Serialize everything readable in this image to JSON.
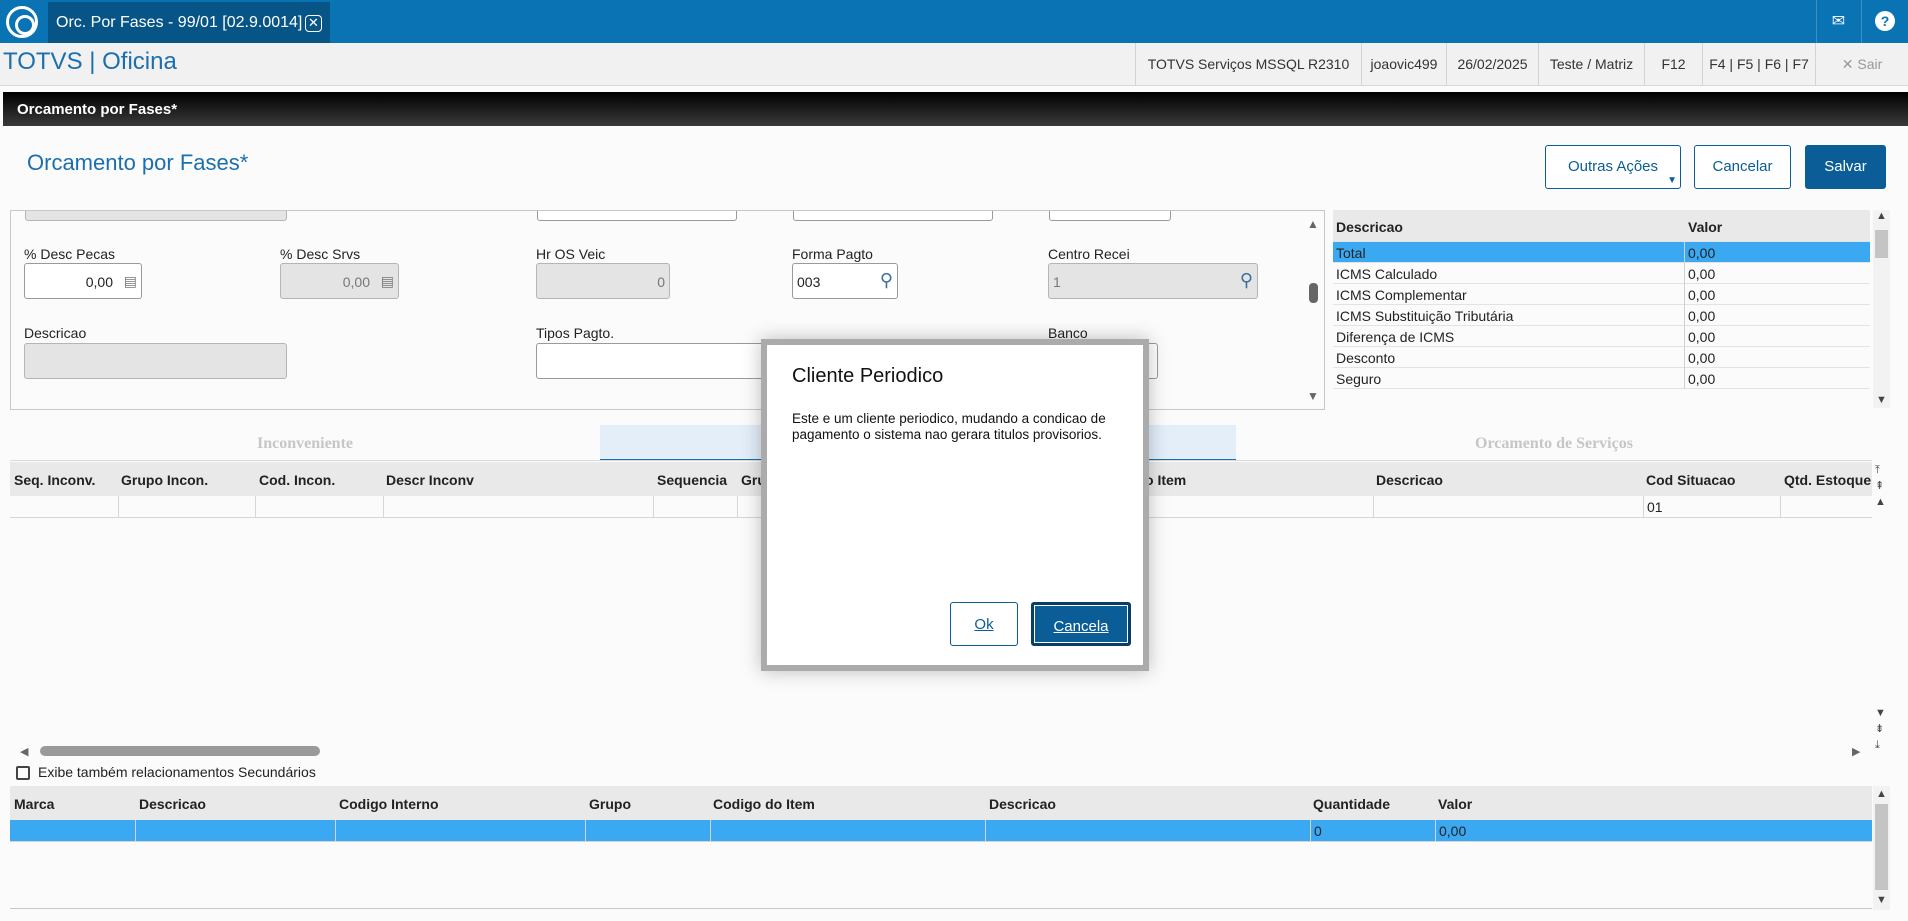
{
  "topbar": {
    "tab_title": "Orc. Por Fases - 99/01 [02.9.0014]",
    "close_glyph": "✕",
    "mail_glyph": "✉",
    "help_glyph": "?"
  },
  "header": {
    "brand": "TOTVS | Oficina",
    "env": "TOTVS Serviços MSSQL R2310",
    "user": "joaovic499",
    "date": "26/02/2025",
    "company": "Teste / Matriz",
    "shortcut1": "F12",
    "shortcut2": "F4 | F5 | F6 | F7",
    "exit": "Sair",
    "exit_glyph": "✕"
  },
  "window_title": "Orcamento por Fases*",
  "page_title": "Orcamento por Fases*",
  "actions": {
    "other": "Outras Ações",
    "cancel": "Cancelar",
    "save": "Salvar"
  },
  "form": {
    "desc_pecas_label": "% Desc Pecas",
    "desc_pecas_value": "0,00",
    "desc_srvs_label": "% Desc Srvs",
    "desc_srvs_value": "0,00",
    "hr_os_label": "Hr OS Veic",
    "hr_os_value": "0",
    "forma_pagto_label": "Forma Pagto",
    "forma_pagto_value": "003",
    "centro_label": "Centro Recei",
    "centro_value": "1",
    "descricao_label": "Descricao",
    "tipos_pagto_label": "Tipos Pagto.",
    "banco_label": "Banco"
  },
  "values_table": {
    "col1": "Descricao",
    "col2": "Valor",
    "rows": [
      {
        "desc": "Total",
        "value": "0,00"
      },
      {
        "desc": "ICMS Calculado",
        "value": "0,00"
      },
      {
        "desc": "ICMS Complementar",
        "value": "0,00"
      },
      {
        "desc": "ICMS Substituição Tributária",
        "value": "0,00"
      },
      {
        "desc": "Diferença de ICMS",
        "value": "0,00"
      },
      {
        "desc": "Desconto",
        "value": "0,00"
      },
      {
        "desc": "Seguro",
        "value": "0,00"
      }
    ]
  },
  "tabs": {
    "t1": "Inconveniente",
    "t3": "Orcamento de Serviços"
  },
  "grid1": {
    "headers": [
      "Seq. Inconv.",
      "Grupo Incon.",
      "Cod. Incon.",
      "Descr Inconv",
      "Sequencia",
      "Gru",
      "o Item",
      "Descricao",
      "Cod Situacao",
      "Qtd. Estoque"
    ],
    "situacao": "01"
  },
  "checkbox_label": "Exibe também relacionamentos Secundários",
  "grid2": {
    "headers": [
      "Marca",
      "Descricao",
      "Codigo Interno",
      "Grupo",
      "Codigo do Item",
      "Descricao",
      "Quantidade",
      "Valor"
    ],
    "quantidade": "0",
    "valor": "0,00"
  },
  "dialog": {
    "title": "Cliente Periodico",
    "message": "Este e um cliente periodico, mudando a condicao de pagamento o sistema nao gerara titulos provisorios.",
    "ok": "Ok",
    "cancel": "Cancela"
  },
  "colors": {
    "brand_blue": "#0a73b3",
    "accent": "#0a5d96",
    "selection": "#3aa9f2"
  }
}
